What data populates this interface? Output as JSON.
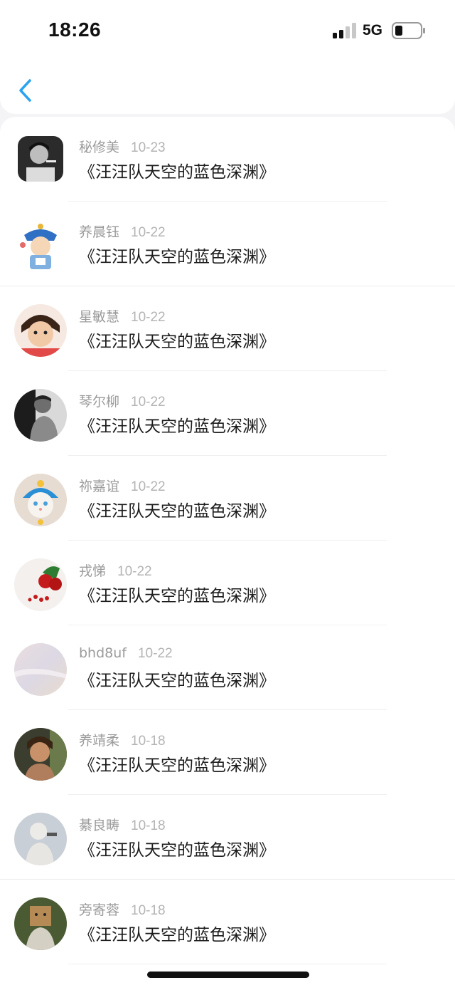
{
  "status_bar": {
    "time": "18:26",
    "network": "5G",
    "icons": [
      "signal-icon",
      "battery-icon"
    ]
  },
  "nav": {
    "back_icon": "chevron-left-icon",
    "accent": "#2aa3f0"
  },
  "comments": [
    {
      "user": "秘修美",
      "date": "10-23",
      "text": "《汪汪队天空的蓝色深渊》"
    },
    {
      "user": "养晨钰",
      "date": "10-22",
      "text": "《汪汪队天空的蓝色深渊》"
    },
    {
      "user": "星敏慧",
      "date": "10-22",
      "text": "《汪汪队天空的蓝色深渊》"
    },
    {
      "user": "琴尔柳",
      "date": "10-22",
      "text": "《汪汪队天空的蓝色深渊》"
    },
    {
      "user": "祢嘉谊",
      "date": "10-22",
      "text": "《汪汪队天空的蓝色深渊》"
    },
    {
      "user": "戎悌",
      "date": "10-22",
      "text": "《汪汪队天空的蓝色深渊》"
    },
    {
      "user": "bhd8uf",
      "date": "10-22",
      "text": "《汪汪队天空的蓝色深渊》"
    },
    {
      "user": "养靖柔",
      "date": "10-18",
      "text": "《汪汪队天空的蓝色深渊》"
    },
    {
      "user": "綦良畴",
      "date": "10-18",
      "text": "《汪汪队天空的蓝色深渊》"
    },
    {
      "user": "旁寄蓉",
      "date": "10-18",
      "text": "《汪汪队天空的蓝色深渊》"
    }
  ]
}
